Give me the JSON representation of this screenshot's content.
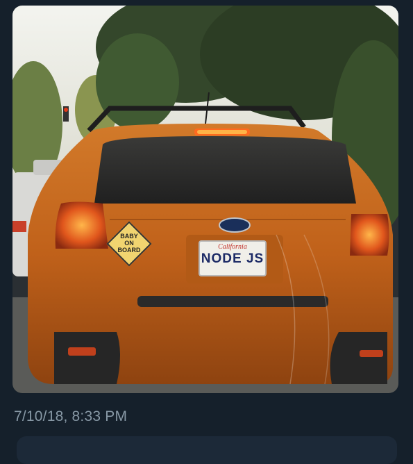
{
  "tweet": {
    "timestamp": "7/10/18, 8:33 PM"
  },
  "photo": {
    "plate_state": "California",
    "plate_text": "NODE JS",
    "sign_line1": "BABY",
    "sign_line2": "ON",
    "sign_line3": "BOARD",
    "car_color": "#c8691c",
    "background_color": "#15202b"
  }
}
